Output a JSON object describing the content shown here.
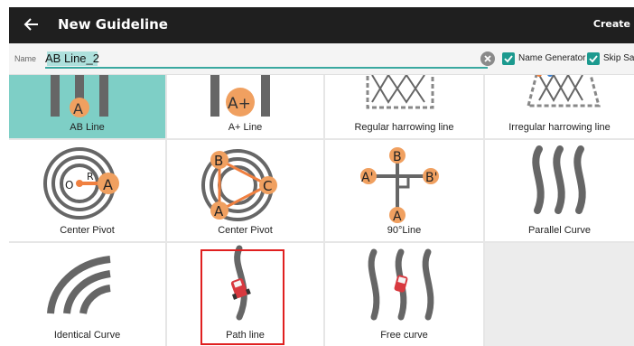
{
  "header": {
    "title": "New Guideline",
    "create_label": "Create"
  },
  "name_field": {
    "label": "Name",
    "value": "AB Line_2"
  },
  "options": {
    "name_generator": "Name Generator",
    "skip_save": "Skip Sav"
  },
  "colors": {
    "accent": "#1c9a8f",
    "selected_tile": "#7ecfc6",
    "orange": "#f0a060",
    "highlight_border": "#e02020"
  },
  "tiles": [
    {
      "label": "AB Line",
      "icon": "ab-line-icon",
      "selected": true,
      "letters": [
        "A"
      ]
    },
    {
      "label": "A+ Line",
      "icon": "a-plus-line-icon",
      "letters": [
        "A+"
      ]
    },
    {
      "label": "Regular harrowing line",
      "icon": "regular-harrowing-icon"
    },
    {
      "label": "Irregular harrowing line",
      "icon": "irregular-harrowing-icon"
    },
    {
      "label": "Center Pivot",
      "icon": "center-pivot-icon",
      "letters": [
        "O",
        "R",
        "A"
      ]
    },
    {
      "label": "Center Pivot",
      "icon": "center-pivot-three-point-icon",
      "letters": [
        "B",
        "C",
        "A"
      ]
    },
    {
      "label": "90°Line",
      "icon": "ninety-degree-line-icon",
      "letters": [
        "B",
        "A'",
        "B'",
        "A"
      ]
    },
    {
      "label": "Parallel Curve",
      "icon": "parallel-curve-icon"
    },
    {
      "label": "Identical Curve",
      "icon": "identical-curve-icon"
    },
    {
      "label": "Path line",
      "icon": "path-line-icon",
      "highlighted": true
    },
    {
      "label": "Free curve",
      "icon": "free-curve-icon"
    }
  ]
}
